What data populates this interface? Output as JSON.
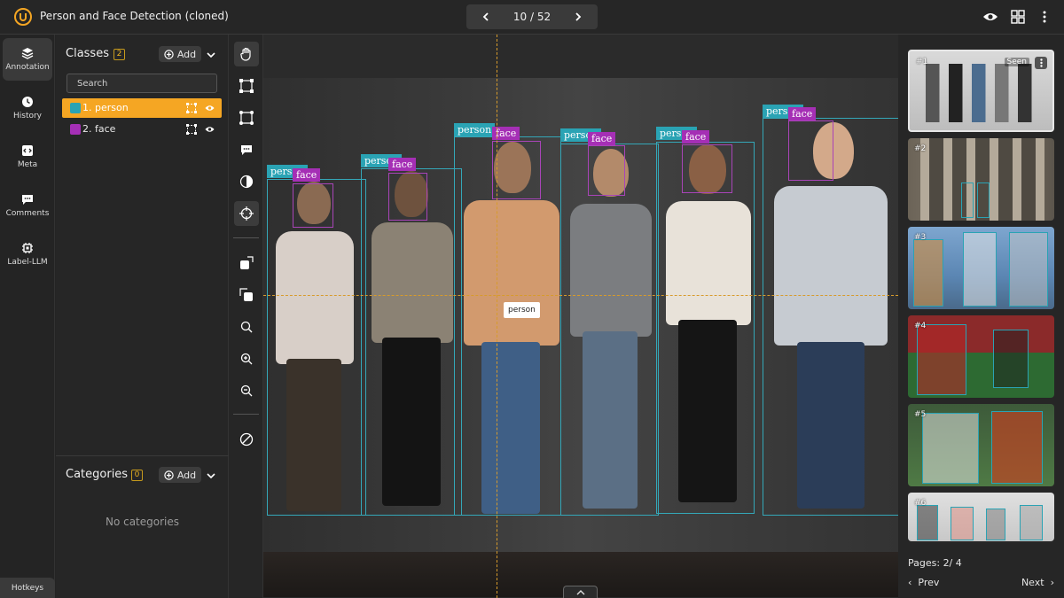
{
  "header": {
    "title": "Person and Face Detection (cloned)",
    "pager": {
      "current": "10 / 52"
    }
  },
  "rail": {
    "items": [
      {
        "label": "Annotation",
        "icon": "layers-icon"
      },
      {
        "label": "History",
        "icon": "clock-icon"
      },
      {
        "label": "Meta",
        "icon": "code-icon"
      },
      {
        "label": "Comments",
        "icon": "comment-icon"
      },
      {
        "label": "Label-LLM",
        "icon": "chip-icon"
      }
    ],
    "hotkeys": "Hotkeys"
  },
  "classes": {
    "title": "Classes",
    "count": "2",
    "add_label": "Add",
    "search_placeholder": "Search",
    "items": [
      {
        "label": "1. person",
        "color": "#2aa3b4"
      },
      {
        "label": "2. face",
        "color": "#a52fb5"
      }
    ]
  },
  "categories": {
    "title": "Categories",
    "count": "0",
    "add_label": "Add",
    "empty": "No categories"
  },
  "canvas": {
    "label_person": "person",
    "label_face": "face",
    "cursor_label": "person"
  },
  "thumbnails": {
    "items": [
      {
        "num": "#1",
        "seen": "Seen"
      },
      {
        "num": "#2"
      },
      {
        "num": "#3"
      },
      {
        "num": "#4"
      },
      {
        "num": "#5"
      },
      {
        "num": "#6"
      }
    ],
    "pages_label": "Pages:  2/ 4",
    "prev": "Prev",
    "next": "Next"
  },
  "colors": {
    "accent": "#f5a623",
    "person": "#2aa3b4",
    "face": "#a52fb5"
  }
}
